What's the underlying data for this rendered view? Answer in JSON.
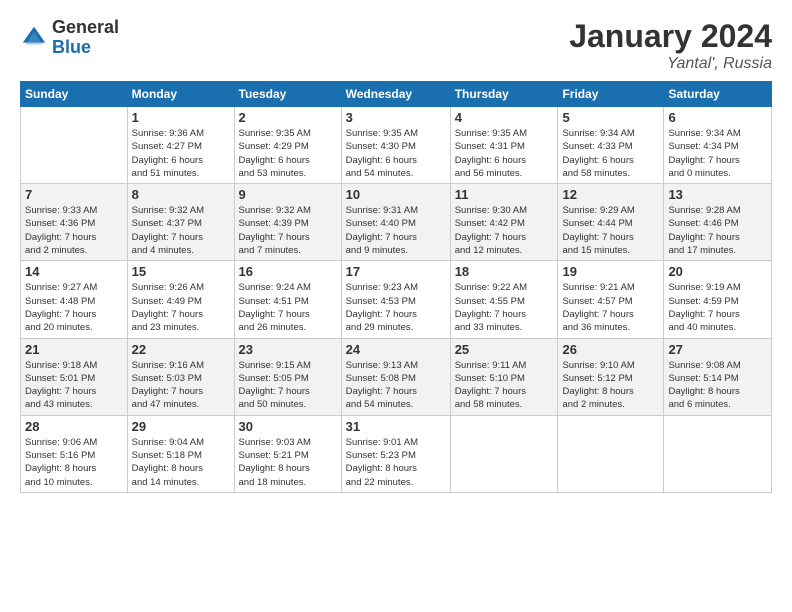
{
  "logo": {
    "general": "General",
    "blue": "Blue"
  },
  "title": {
    "month": "January 2024",
    "location": "Yantal', Russia"
  },
  "days_of_week": [
    "Sunday",
    "Monday",
    "Tuesday",
    "Wednesday",
    "Thursday",
    "Friday",
    "Saturday"
  ],
  "weeks": [
    [
      {
        "day": "",
        "info": ""
      },
      {
        "day": "1",
        "info": "Sunrise: 9:36 AM\nSunset: 4:27 PM\nDaylight: 6 hours\nand 51 minutes."
      },
      {
        "day": "2",
        "info": "Sunrise: 9:35 AM\nSunset: 4:29 PM\nDaylight: 6 hours\nand 53 minutes."
      },
      {
        "day": "3",
        "info": "Sunrise: 9:35 AM\nSunset: 4:30 PM\nDaylight: 6 hours\nand 54 minutes."
      },
      {
        "day": "4",
        "info": "Sunrise: 9:35 AM\nSunset: 4:31 PM\nDaylight: 6 hours\nand 56 minutes."
      },
      {
        "day": "5",
        "info": "Sunrise: 9:34 AM\nSunset: 4:33 PM\nDaylight: 6 hours\nand 58 minutes."
      },
      {
        "day": "6",
        "info": "Sunrise: 9:34 AM\nSunset: 4:34 PM\nDaylight: 7 hours\nand 0 minutes."
      }
    ],
    [
      {
        "day": "7",
        "info": "Sunrise: 9:33 AM\nSunset: 4:36 PM\nDaylight: 7 hours\nand 2 minutes."
      },
      {
        "day": "8",
        "info": "Sunrise: 9:32 AM\nSunset: 4:37 PM\nDaylight: 7 hours\nand 4 minutes."
      },
      {
        "day": "9",
        "info": "Sunrise: 9:32 AM\nSunset: 4:39 PM\nDaylight: 7 hours\nand 7 minutes."
      },
      {
        "day": "10",
        "info": "Sunrise: 9:31 AM\nSunset: 4:40 PM\nDaylight: 7 hours\nand 9 minutes."
      },
      {
        "day": "11",
        "info": "Sunrise: 9:30 AM\nSunset: 4:42 PM\nDaylight: 7 hours\nand 12 minutes."
      },
      {
        "day": "12",
        "info": "Sunrise: 9:29 AM\nSunset: 4:44 PM\nDaylight: 7 hours\nand 15 minutes."
      },
      {
        "day": "13",
        "info": "Sunrise: 9:28 AM\nSunset: 4:46 PM\nDaylight: 7 hours\nand 17 minutes."
      }
    ],
    [
      {
        "day": "14",
        "info": "Sunrise: 9:27 AM\nSunset: 4:48 PM\nDaylight: 7 hours\nand 20 minutes."
      },
      {
        "day": "15",
        "info": "Sunrise: 9:26 AM\nSunset: 4:49 PM\nDaylight: 7 hours\nand 23 minutes."
      },
      {
        "day": "16",
        "info": "Sunrise: 9:24 AM\nSunset: 4:51 PM\nDaylight: 7 hours\nand 26 minutes."
      },
      {
        "day": "17",
        "info": "Sunrise: 9:23 AM\nSunset: 4:53 PM\nDaylight: 7 hours\nand 29 minutes."
      },
      {
        "day": "18",
        "info": "Sunrise: 9:22 AM\nSunset: 4:55 PM\nDaylight: 7 hours\nand 33 minutes."
      },
      {
        "day": "19",
        "info": "Sunrise: 9:21 AM\nSunset: 4:57 PM\nDaylight: 7 hours\nand 36 minutes."
      },
      {
        "day": "20",
        "info": "Sunrise: 9:19 AM\nSunset: 4:59 PM\nDaylight: 7 hours\nand 40 minutes."
      }
    ],
    [
      {
        "day": "21",
        "info": "Sunrise: 9:18 AM\nSunset: 5:01 PM\nDaylight: 7 hours\nand 43 minutes."
      },
      {
        "day": "22",
        "info": "Sunrise: 9:16 AM\nSunset: 5:03 PM\nDaylight: 7 hours\nand 47 minutes."
      },
      {
        "day": "23",
        "info": "Sunrise: 9:15 AM\nSunset: 5:05 PM\nDaylight: 7 hours\nand 50 minutes."
      },
      {
        "day": "24",
        "info": "Sunrise: 9:13 AM\nSunset: 5:08 PM\nDaylight: 7 hours\nand 54 minutes."
      },
      {
        "day": "25",
        "info": "Sunrise: 9:11 AM\nSunset: 5:10 PM\nDaylight: 7 hours\nand 58 minutes."
      },
      {
        "day": "26",
        "info": "Sunrise: 9:10 AM\nSunset: 5:12 PM\nDaylight: 8 hours\nand 2 minutes."
      },
      {
        "day": "27",
        "info": "Sunrise: 9:08 AM\nSunset: 5:14 PM\nDaylight: 8 hours\nand 6 minutes."
      }
    ],
    [
      {
        "day": "28",
        "info": "Sunrise: 9:06 AM\nSunset: 5:16 PM\nDaylight: 8 hours\nand 10 minutes."
      },
      {
        "day": "29",
        "info": "Sunrise: 9:04 AM\nSunset: 5:18 PM\nDaylight: 8 hours\nand 14 minutes."
      },
      {
        "day": "30",
        "info": "Sunrise: 9:03 AM\nSunset: 5:21 PM\nDaylight: 8 hours\nand 18 minutes."
      },
      {
        "day": "31",
        "info": "Sunrise: 9:01 AM\nSunset: 5:23 PM\nDaylight: 8 hours\nand 22 minutes."
      },
      {
        "day": "",
        "info": ""
      },
      {
        "day": "",
        "info": ""
      },
      {
        "day": "",
        "info": ""
      }
    ]
  ]
}
